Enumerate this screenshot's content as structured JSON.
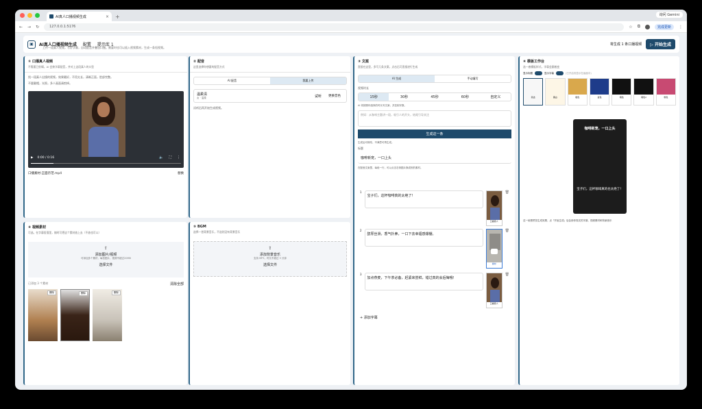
{
  "browser": {
    "tab_title": "AI真人口播视频生成",
    "url": "127.0.0.1:5176",
    "gemini": "询问 Gemini",
    "update": "完成更新"
  },
  "header": {
    "title": "AI真人口播视频生成",
    "nav1": "配置",
    "nav2": "提示库 1",
    "subtitle": "上传一段真人视频，写好字幕，自动配音并叠加口播。需要时也可以插入视频素材，生成一条短视频。",
    "status": "将生成 1 条口播视频",
    "start": "▷ 开始生成"
  },
  "card1": {
    "title": "① 口播真人视频",
    "sub": "不需要已剪辑，AI 会按字幕配音，并对上这段真人的口型",
    "desc1": "找一段真人出镜的视频，效果最好，不用太长，清晰正面，脸部完整。",
    "desc2": "不要戴帽，光照，多人画面请剪掉。",
    "time": "0:00 / 0:16",
    "file": "口播素材-正面示范.mp4",
    "replace": "替换"
  },
  "card2": {
    "title": "② 配音",
    "sub": "这里选择你想要的配音方式",
    "tab1": "AI 配音",
    "tab2": "我要上传",
    "voice": "温柔清",
    "voice_sub": "女 · 温柔",
    "try": "试听",
    "change": "更换音色",
    "hint": "试听后再开始生成视频。"
  },
  "card3": {
    "title": "③ 文案",
    "sub": "直接在这里，多写几条文案，点击后可直接进行生成",
    "tab1": "AI 生成",
    "tab2": "手动填写",
    "len_label": "视频时长",
    "durations": [
      "15秒",
      "30秒",
      "45秒",
      "60秒",
      "自定义"
    ],
    "len_hint": "AI 将按照你选择的时长写文案，并控制字数。",
    "placeholder": "例如：从咖啡主题讲一段，吸引人的开头，结尾引导关注",
    "gen": "生成这一条",
    "gen_note": "生成后可修改，不满意可再生成。",
    "title_label": "标题",
    "title_value": "咖啡新宠，一口上头",
    "para_label": "在配音文案里，每段一行，可以点击右侧图片换成别的素材。",
    "paras": [
      "宝子们，这杯咖啡真的太绝了！",
      "醇厚丝滑，香气扑鼻，一口下去幸福感爆棚。",
      "加点燕麦，下午茶必备，赶紧来尝鲜，错过真的会后悔哦！"
    ],
    "thumb_labels": [
      "口播真人",
      "素材",
      "口播真人"
    ],
    "add": "+ 添加字幕"
  },
  "card4": {
    "title": "④ 视频素材",
    "sub": "可选。在字幕段落里，随时可把这个素材放上去（不放也可以）",
    "upload": "添加图片/视频",
    "upload_sub": "可添加多个素材，每张图片、视频不超过20MB",
    "choose": "选择文件",
    "count": "已添加 3 个素材",
    "clear": "清除全部",
    "remove": "删除"
  },
  "card5": {
    "title": "⑤ BGM",
    "sub": "选择一首背景音乐，不选则没有背景音乐",
    "upload": "添加背景音乐",
    "upload_sub": "支持 MP3，时长不超过 5 分钟",
    "choose": "选择文件"
  },
  "card6": {
    "title": "⑥ 模板工作台",
    "sub": "选一套模板样式，字幕会跟着变",
    "toggle1": "显示标题",
    "toggle2": "显示字幕",
    "toggle_hint": "(已开启则显示在画面中)",
    "templates": [
      "简洁",
      "黑白",
      "暖色",
      "蓝色",
      "暗色",
      "暗色2",
      "粉色"
    ],
    "preview_title": "咖啡新宠，一口上头",
    "preview_text": "宝子们，这杯咖啡真的也太绝了！",
    "note": "这一帧是预览生成效果，点「开始生成」后会用你真实的字幕、视频素材和背景音乐"
  },
  "colors": {
    "accent": "#1e4a6b",
    "border": "#2f6688",
    "active": "#dde9f3"
  }
}
